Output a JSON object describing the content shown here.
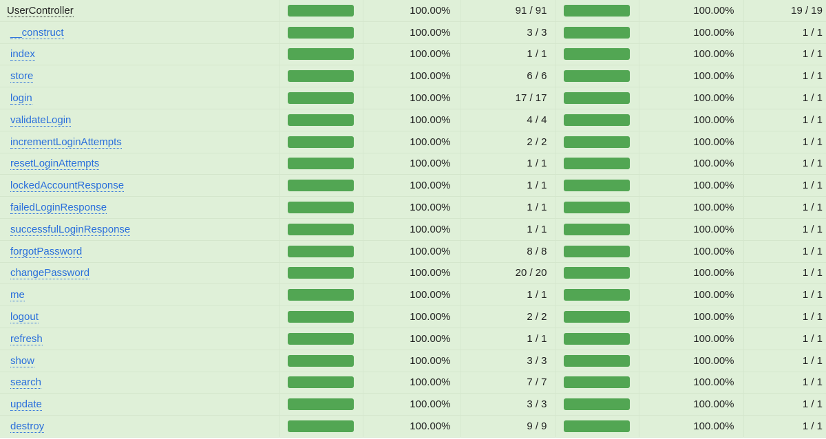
{
  "colors": {
    "row_bg": "#dff0d8",
    "bar_success": "#52a653",
    "link": "#2a6fdb"
  },
  "rows": [
    {
      "name": "UserController",
      "lines_pct": "100.00%",
      "lines": "91 / 91",
      "lines_fill": 100,
      "methods_pct": "100.00%",
      "methods": "19 / 19",
      "methods_fill": 100
    },
    {
      "name": "__construct",
      "lines_pct": "100.00%",
      "lines": "3 / 3",
      "lines_fill": 100,
      "methods_pct": "100.00%",
      "methods": "1 / 1",
      "methods_fill": 100
    },
    {
      "name": "index",
      "lines_pct": "100.00%",
      "lines": "1 / 1",
      "lines_fill": 100,
      "methods_pct": "100.00%",
      "methods": "1 / 1",
      "methods_fill": 100
    },
    {
      "name": "store",
      "lines_pct": "100.00%",
      "lines": "6 / 6",
      "lines_fill": 100,
      "methods_pct": "100.00%",
      "methods": "1 / 1",
      "methods_fill": 100
    },
    {
      "name": "login",
      "lines_pct": "100.00%",
      "lines": "17 / 17",
      "lines_fill": 100,
      "methods_pct": "100.00%",
      "methods": "1 / 1",
      "methods_fill": 100
    },
    {
      "name": "validateLogin",
      "lines_pct": "100.00%",
      "lines": "4 / 4",
      "lines_fill": 100,
      "methods_pct": "100.00%",
      "methods": "1 / 1",
      "methods_fill": 100
    },
    {
      "name": "incrementLoginAttempts",
      "lines_pct": "100.00%",
      "lines": "2 / 2",
      "lines_fill": 100,
      "methods_pct": "100.00%",
      "methods": "1 / 1",
      "methods_fill": 100
    },
    {
      "name": "resetLoginAttempts",
      "lines_pct": "100.00%",
      "lines": "1 / 1",
      "lines_fill": 100,
      "methods_pct": "100.00%",
      "methods": "1 / 1",
      "methods_fill": 100
    },
    {
      "name": "lockedAccountResponse",
      "lines_pct": "100.00%",
      "lines": "1 / 1",
      "lines_fill": 100,
      "methods_pct": "100.00%",
      "methods": "1 / 1",
      "methods_fill": 100
    },
    {
      "name": "failedLoginResponse",
      "lines_pct": "100.00%",
      "lines": "1 / 1",
      "lines_fill": 100,
      "methods_pct": "100.00%",
      "methods": "1 / 1",
      "methods_fill": 100
    },
    {
      "name": "successfulLoginResponse",
      "lines_pct": "100.00%",
      "lines": "1 / 1",
      "lines_fill": 100,
      "methods_pct": "100.00%",
      "methods": "1 / 1",
      "methods_fill": 100
    },
    {
      "name": "forgotPassword",
      "lines_pct": "100.00%",
      "lines": "8 / 8",
      "lines_fill": 100,
      "methods_pct": "100.00%",
      "methods": "1 / 1",
      "methods_fill": 100
    },
    {
      "name": "changePassword",
      "lines_pct": "100.00%",
      "lines": "20 / 20",
      "lines_fill": 100,
      "methods_pct": "100.00%",
      "methods": "1 / 1",
      "methods_fill": 100
    },
    {
      "name": "me",
      "lines_pct": "100.00%",
      "lines": "1 / 1",
      "lines_fill": 100,
      "methods_pct": "100.00%",
      "methods": "1 / 1",
      "methods_fill": 100
    },
    {
      "name": "logout",
      "lines_pct": "100.00%",
      "lines": "2 / 2",
      "lines_fill": 100,
      "methods_pct": "100.00%",
      "methods": "1 / 1",
      "methods_fill": 100
    },
    {
      "name": "refresh",
      "lines_pct": "100.00%",
      "lines": "1 / 1",
      "lines_fill": 100,
      "methods_pct": "100.00%",
      "methods": "1 / 1",
      "methods_fill": 100
    },
    {
      "name": "show",
      "lines_pct": "100.00%",
      "lines": "3 / 3",
      "lines_fill": 100,
      "methods_pct": "100.00%",
      "methods": "1 / 1",
      "methods_fill": 100
    },
    {
      "name": "search",
      "lines_pct": "100.00%",
      "lines": "7 / 7",
      "lines_fill": 100,
      "methods_pct": "100.00%",
      "methods": "1 / 1",
      "methods_fill": 100
    },
    {
      "name": "update",
      "lines_pct": "100.00%",
      "lines": "3 / 3",
      "lines_fill": 100,
      "methods_pct": "100.00%",
      "methods": "1 / 1",
      "methods_fill": 100
    },
    {
      "name": "destroy",
      "lines_pct": "100.00%",
      "lines": "9 / 9",
      "lines_fill": 100,
      "methods_pct": "100.00%",
      "methods": "1 / 1",
      "methods_fill": 100
    }
  ]
}
